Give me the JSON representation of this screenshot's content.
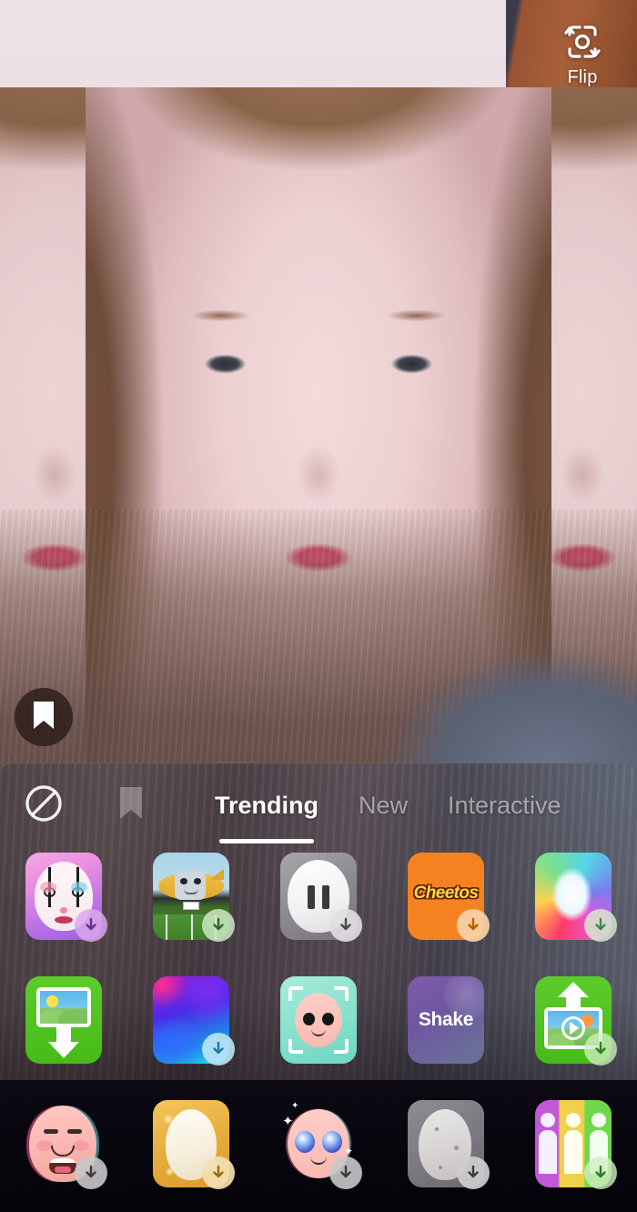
{
  "app": {
    "name": "camera-effects-picker",
    "accent": "#ffffff"
  },
  "camera": {
    "flip_button": {
      "label": "Flip",
      "icon": "camera-flip-icon"
    },
    "save_button": {
      "icon": "bookmark-icon",
      "state": "unsaved"
    }
  },
  "panel": {
    "left_icons": [
      {
        "name": "no-effect",
        "icon": "circle-slash-icon",
        "active": false
      },
      {
        "name": "saved-effects",
        "icon": "bookmark-icon",
        "active": false
      }
    ],
    "tabs": [
      {
        "id": "trending",
        "label": "Trending",
        "active": true
      },
      {
        "id": "new",
        "label": "New",
        "active": false
      },
      {
        "id": "interactive",
        "label": "Interactive",
        "active": false
      }
    ],
    "effects": [
      {
        "id": "clown-face",
        "label": "Clown Face",
        "art": "art-clown",
        "face": "clown",
        "download": true,
        "badge_tint": "#d9a7ef"
      },
      {
        "id": "football-blimp",
        "label": "Football Blimp",
        "art": "art-blimp",
        "face": "blimp",
        "download": true,
        "badge_tint": "#cfe6c4"
      },
      {
        "id": "pause-face",
        "label": "Pause",
        "art": "art-pause",
        "face": "pause",
        "download": true,
        "badge_tint": "#e2e0e2"
      },
      {
        "id": "cheetos",
        "label": "Cheetos",
        "art": "art-cheetos",
        "face": "cheetos",
        "download": true,
        "badge_tint": "#f7d3a8"
      },
      {
        "id": "rainbow-swirl",
        "label": "Rainbow Swirl",
        "art": "art-rainbow",
        "face": "plain",
        "download": true,
        "badge_tint": "#d7f0cf"
      },
      {
        "id": "photo-import",
        "label": "Photo Import",
        "art": "art-green",
        "face": "photo-down",
        "download": false,
        "badge_tint": "#ffffff"
      },
      {
        "id": "color-fluid",
        "label": "Color Fluid",
        "art": "art-fluid",
        "face": "plain",
        "download": true,
        "badge_tint": "#bde4f5"
      },
      {
        "id": "scan-face",
        "label": "Scan Face",
        "art": "art-mint",
        "face": "scan",
        "download": false,
        "badge_tint": "#ffffff"
      },
      {
        "id": "shake",
        "label": "Shake",
        "art": "art-shake",
        "face": "text",
        "download": false,
        "badge_tint": "#ffffff"
      },
      {
        "id": "video-upload",
        "label": "Video Upload",
        "art": "art-green",
        "face": "video-up",
        "download": true,
        "badge_tint": "#cfeec2"
      },
      {
        "id": "big-mouth",
        "label": "Big Mouth",
        "art": "none",
        "face": "grin",
        "download": true,
        "badge_tint": "#c9c7c9"
      },
      {
        "id": "golden-glow",
        "label": "Golden Glow",
        "art": "art-gold",
        "face": "egghead",
        "download": true,
        "badge_tint": "#f3e0b4"
      },
      {
        "id": "sparkle-eyes",
        "label": "Sparkle Eyes",
        "art": "none",
        "face": "sparkle",
        "download": true,
        "badge_tint": "#c9c7c9"
      },
      {
        "id": "stone-head",
        "label": "Stone Head",
        "art": "art-grey",
        "face": "stone",
        "download": true,
        "badge_tint": "#cfcdcf"
      },
      {
        "id": "rainbow-people",
        "label": "Rainbow People",
        "art": "art-people",
        "face": "people",
        "download": true,
        "badge_tint": "#cfeec2"
      }
    ],
    "shake_tile_text": "Shake",
    "cheetos_tile_text": "Cheetos"
  }
}
